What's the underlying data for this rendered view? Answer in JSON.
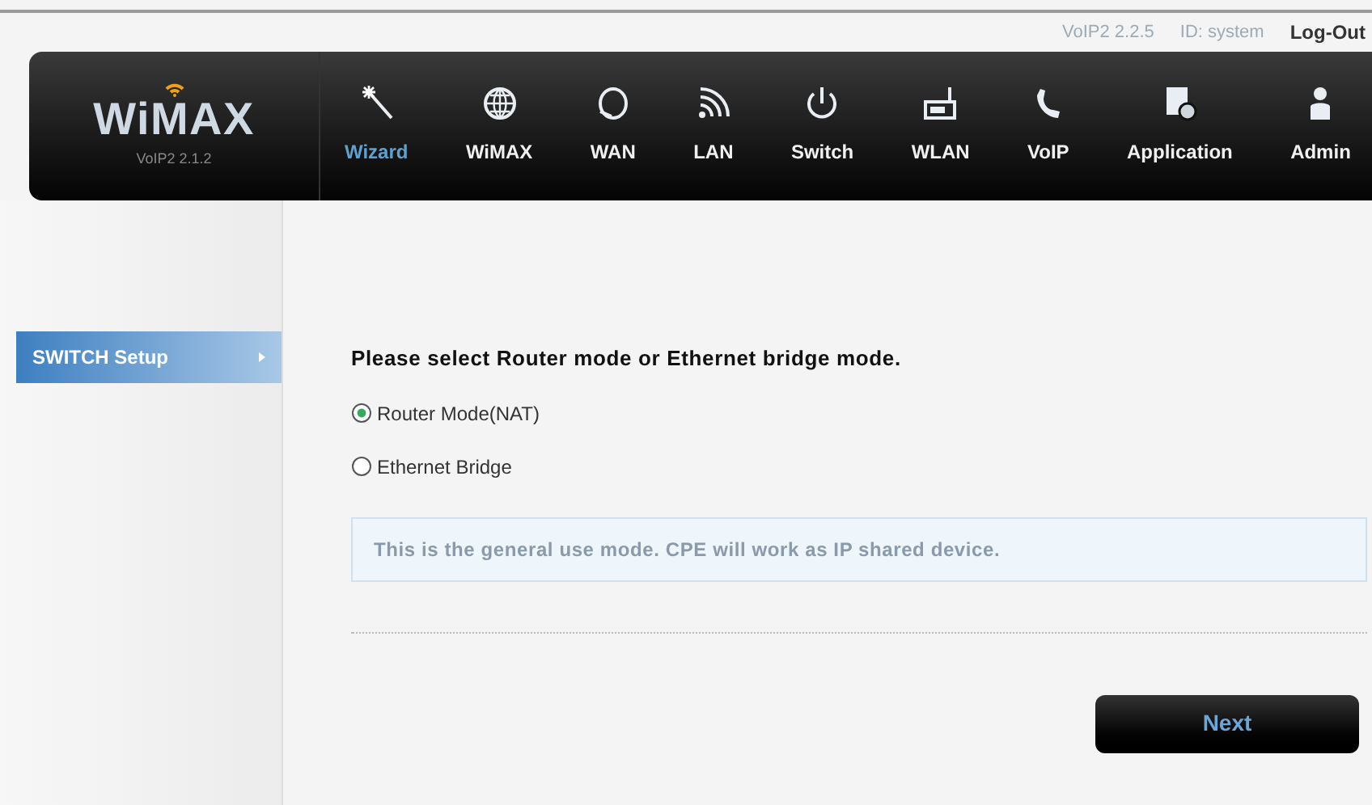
{
  "top_bar": {
    "version": "VoIP2 2.2.5",
    "user_id": "ID: system",
    "logout": "Log-Out"
  },
  "logo": {
    "title": "WiMAX",
    "version": "VoIP2 2.1.2"
  },
  "nav": [
    {
      "label": "Wizard",
      "selected": true
    },
    {
      "label": "WiMAX",
      "selected": false
    },
    {
      "label": "WAN",
      "selected": false
    },
    {
      "label": "LAN",
      "selected": false
    },
    {
      "label": "Switch",
      "selected": false
    },
    {
      "label": "WLAN",
      "selected": false
    },
    {
      "label": "VoIP",
      "selected": false
    },
    {
      "label": "Application",
      "selected": false
    },
    {
      "label": "Admin",
      "selected": false
    }
  ],
  "sidebar": {
    "items": [
      {
        "label": "SWITCH Setup",
        "selected": true
      }
    ]
  },
  "content": {
    "heading": "Please select Router mode or Ethernet bridge mode.",
    "options": [
      {
        "label": "Router Mode(NAT)",
        "selected": true
      },
      {
        "label": "Ethernet Bridge",
        "selected": false
      }
    ],
    "info": "This is the general use mode. CPE will work as IP shared device.",
    "next_button": "Next"
  }
}
